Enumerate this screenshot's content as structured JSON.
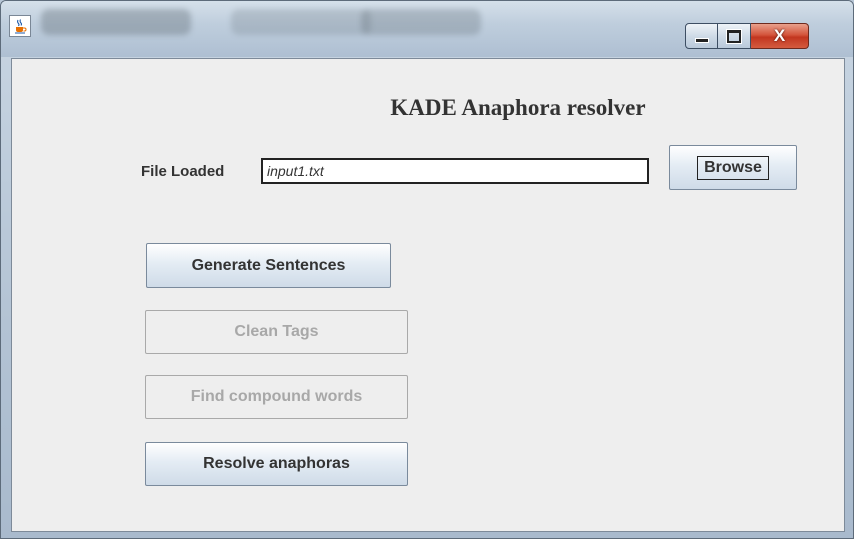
{
  "window": {
    "title_text": "",
    "icon": "java-coffee-icon",
    "controls": {
      "minimize_icon": "minimize-icon",
      "maximize_icon": "maximize-icon",
      "close_label": "X"
    }
  },
  "main": {
    "heading": "KADE Anaphora resolver",
    "file_loaded_label": "File Loaded",
    "file_value": "input1.txt",
    "browse_label": "Browse",
    "buttons": [
      {
        "label": "Generate Sentences",
        "enabled": true
      },
      {
        "label": "Clean Tags",
        "enabled": false
      },
      {
        "label": "Find compound words",
        "enabled": false
      },
      {
        "label": "Resolve anaphoras",
        "enabled": true
      }
    ]
  },
  "colors": {
    "client_background": "#eeeeee",
    "close_button": "#c2361f",
    "disabled_text": "#a8a8a8"
  }
}
